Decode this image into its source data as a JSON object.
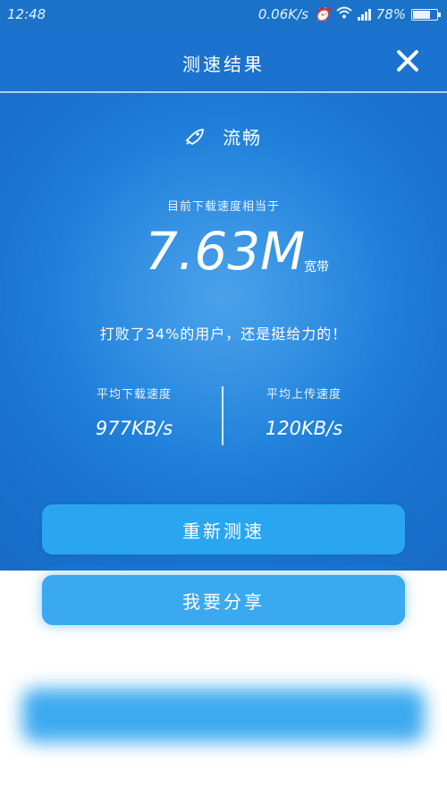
{
  "status_bar": {
    "time": "12:48",
    "net_speed": "0.06K/s",
    "battery": "78%",
    "battery_level": 0.78
  },
  "header": {
    "title": "测速结果"
  },
  "result": {
    "status": "流畅",
    "subtitle": "目前下载速度相当于",
    "speed": "7.63M",
    "unit": "宽带",
    "beat": "打败了34%的用户，还是挺给力的！"
  },
  "stats": {
    "download_label": "平均下载速度",
    "download_value": "977KB/s",
    "upload_label": "平均上传速度",
    "upload_value": "120KB/s"
  },
  "buttons": {
    "retest": "重新测速",
    "share": "我要分享"
  },
  "colors": {
    "primary": "#1b72cf",
    "button": "#2aa6f1"
  }
}
